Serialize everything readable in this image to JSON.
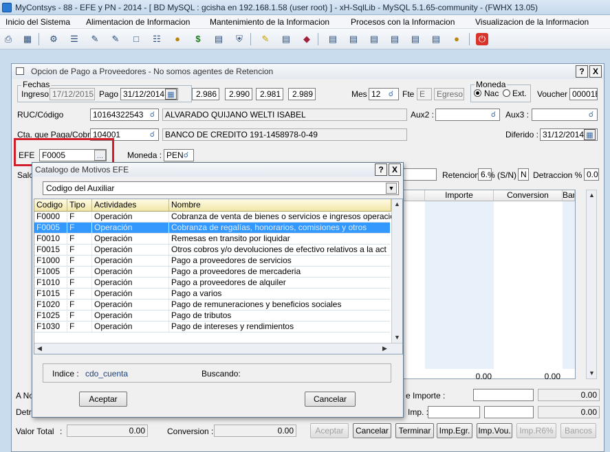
{
  "window": {
    "title": "MyContsys - 88 - EFE y PN - 2014 - [ BD MySQL : gcisha en 192.168.1.58 (user root) ] - xH-SqlLib - MySQL 5.1.65-community - (FWHX 13.05)"
  },
  "menu": [
    "Inicio del Sistema",
    "Alimentacion de Informacion",
    "Mantenimiento de la Informacion",
    "Procesos con la Informacion",
    "Visualizacion de la Informacion"
  ],
  "toolbar_icons": [
    "printer-icon",
    "calculator-icon",
    "tools-icon",
    "list-icon",
    "edit-doc-icon",
    "edit-doc2-icon",
    "new-doc-icon",
    "tree-icon",
    "users-icon",
    "dollar-icon",
    "calendar-icon",
    "shield-icon",
    "pencil-icon",
    "note-icon",
    "diamond-icon",
    "report1-icon",
    "report2-icon",
    "report3-icon",
    "report4-icon",
    "report5-icon",
    "report6-icon",
    "report7-icon",
    "users2-icon",
    "exit-icon"
  ],
  "main": {
    "title": "Opcion de Pago a Proveedores - No somos agentes de Retencion",
    "help": "?",
    "close": "X",
    "fechas": {
      "legend": "Fechas",
      "ingreso_label": "Ingreso",
      "ingreso_value": "17/12/2015",
      "pago_label": "Pago",
      "pago_value": "31/12/2014"
    },
    "rates": [
      "2.986",
      "2.990",
      "2.981",
      "2.989"
    ],
    "mes_label": "Mes",
    "mes_value": "12",
    "fte_label": "Fte",
    "fte_value": "E",
    "egreso_placeholder": "Egreso",
    "moneda": {
      "legend": "Moneda",
      "nac": "Nac",
      "ext": "Ext."
    },
    "voucher_label": "Voucher",
    "voucher_value": "00001E",
    "ruc_label": "RUC/Código",
    "ruc_value": "10164322543",
    "ruc_name": "ALVARADO QUIJANO WELTI ISABEL",
    "aux2_label": "Aux2 :",
    "aux3_label": "Aux3 :",
    "cta_label": "Cta. que Paga/Cobra",
    "cta_value": "104001",
    "cta_name": "BANCO DE CREDITO 191-1458978-0-49",
    "diferido_label": "Diferido :",
    "diferido_value": "31/12/2014",
    "efe_label": "EFE",
    "efe_value": "F0005",
    "moneda_label": "Moneda :",
    "moneda_value": "PEN",
    "sal_label": "Salc",
    "retencion_label": "Retencion",
    "retencion_pct": "6.",
    "sn_label": "% (S/N)",
    "sn_value": "N",
    "detraccion_label": "Detraccion %",
    "detraccion_value": "0.0",
    "grid_headers": [
      "Importe",
      "Conversion",
      "Banco"
    ],
    "grid_totals": [
      "0.00",
      "0.00"
    ],
    "ano_label": "A No",
    "importe_label": "e Importe :",
    "importe_total": "0.00",
    "detr_label": "Detra",
    "imp_label": "Imp. :",
    "imp_total": "0.00",
    "valor_total_label": "Valor Total",
    "valor_total_value": "0.00",
    "conversion_label": "Conversion :",
    "conversion_value": "0.00",
    "buttons": [
      "Aceptar",
      "Cancelar",
      "Terminar",
      "Imp.Egr.",
      "Imp.Vou.",
      "Imp.R6%",
      "Bancos"
    ]
  },
  "catalog": {
    "title": "Catalogo de Motivos EFE",
    "help": "?",
    "close": "X",
    "order_by": "Codigo del Auxiliar",
    "columns": [
      "Codigo",
      "Tipo",
      "Actividades",
      "Nombre"
    ],
    "rows": [
      [
        "F0000",
        "F",
        "Operación",
        "Cobranza de venta de bienes o servicios e ingresos operacion"
      ],
      [
        "F0005",
        "F",
        "Operación",
        "Cobranza de regalías, honorarios, comisiones y otros"
      ],
      [
        "F0010",
        "F",
        "Operación",
        "Remesas en transito por liquidar"
      ],
      [
        "F0015",
        "F",
        "Operación",
        "Otros cobros y/o devoluciones de efectivo relativos a la act"
      ],
      [
        "F1000",
        "F",
        "Operación",
        "Pago a proveedores de servicios"
      ],
      [
        "F1005",
        "F",
        "Operación",
        "Pago a proveedores de mercaderia"
      ],
      [
        "F1010",
        "F",
        "Operación",
        "Pago a proveedores de alquiler"
      ],
      [
        "F1015",
        "F",
        "Operación",
        "Pago a varios"
      ],
      [
        "F1020",
        "F",
        "Operación",
        "Pago de remuneraciones y beneficios sociales"
      ],
      [
        "F1025",
        "F",
        "Operación",
        "Pago de tributos"
      ],
      [
        "F1030",
        "F",
        "Operación",
        "Pago de intereses y rendimientos"
      ],
      [
        "",
        "",
        "",
        ""
      ]
    ],
    "selected_index": 1,
    "indice_label": "Indice :",
    "indice_value": "cdo_cuenta",
    "buscando_label": "Buscando:",
    "accept": "Aceptar",
    "cancel": "Cancelar"
  }
}
